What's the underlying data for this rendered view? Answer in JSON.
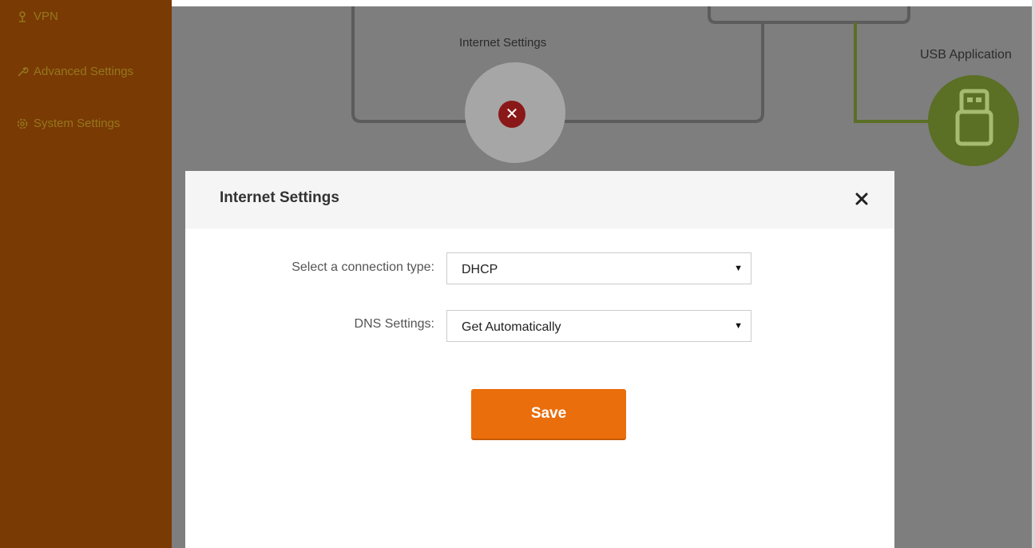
{
  "sidebar": {
    "items": [
      {
        "label": "VPN",
        "icon": "vpn-icon"
      },
      {
        "label": "Advanced Settings",
        "icon": "wrench-icon"
      },
      {
        "label": "System Settings",
        "icon": "gear-icon"
      }
    ]
  },
  "diagram": {
    "internet_label": "Internet Settings",
    "usb_label": "USB Application",
    "internet_status_icon": "error-x-icon",
    "usb_icon": "usb-drive-icon"
  },
  "modal": {
    "title": "Internet Settings",
    "close_icon": "close-icon",
    "connection_type": {
      "label": "Select a connection type:",
      "value": "DHCP"
    },
    "dns": {
      "label": "DNS Settings:",
      "value": "Get Automatically"
    },
    "save_label": "Save"
  },
  "colors": {
    "sidebar_bg": "#7a3a04",
    "overlay_bg": "#7e7e7e",
    "accent_orange": "#ea6e0c",
    "usb_green": "#5b6f25",
    "error_red": "#8b1818"
  }
}
